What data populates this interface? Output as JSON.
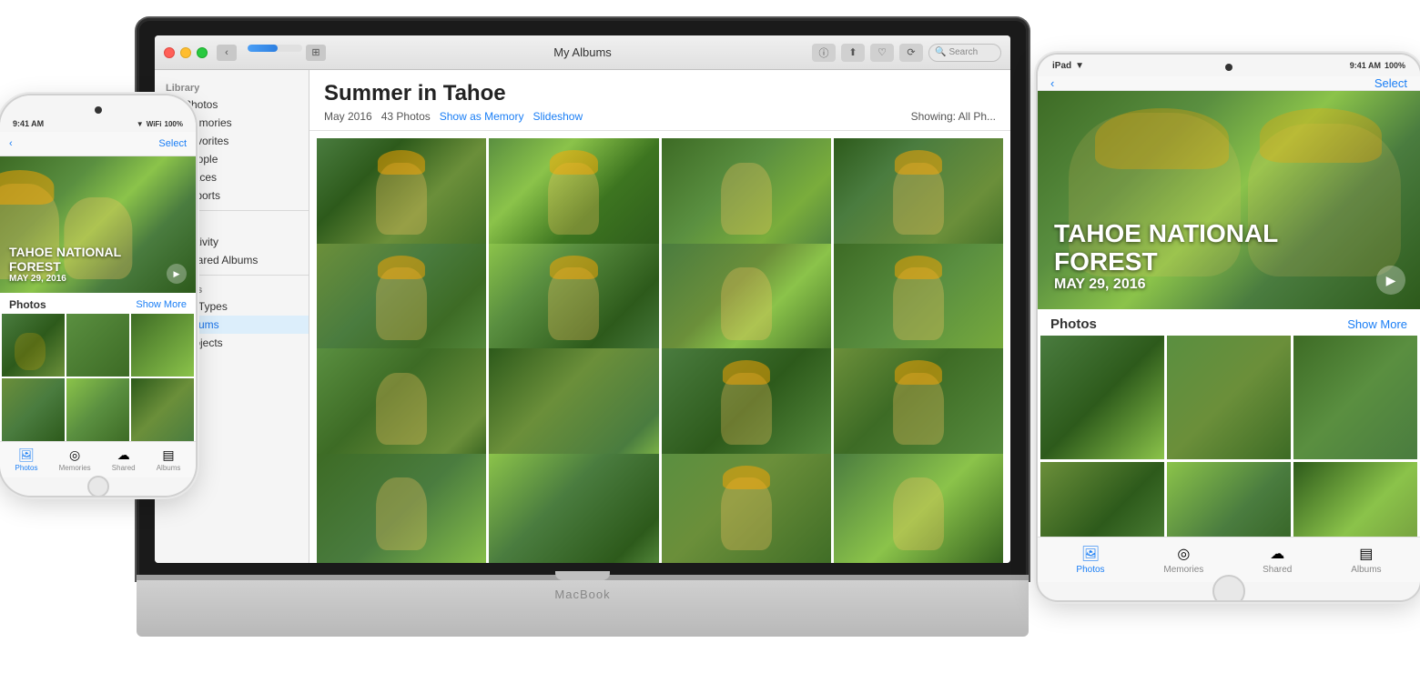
{
  "page": {
    "bg_color": "#ffffff"
  },
  "macbook": {
    "label": "MacBook"
  },
  "photos_app": {
    "title_bar": {
      "title": "My Albums",
      "search_placeholder": "Search",
      "back_label": "‹",
      "forward_label": "›"
    },
    "sidebar": {
      "library_header": "Library",
      "items": [
        {
          "label": "Photos",
          "icon": "🖼"
        },
        {
          "label": "Memories",
          "icon": "◎"
        },
        {
          "label": "Favorites",
          "icon": "♡"
        },
        {
          "label": "People",
          "icon": "👤"
        },
        {
          "label": "Places",
          "icon": "📍"
        },
        {
          "label": "Imports",
          "icon": "↓"
        }
      ],
      "shared_header": "Shared",
      "shared_items": [
        {
          "label": "Activity",
          "icon": "☁"
        },
        {
          "label": "Shared Albums",
          "icon": "▶"
        }
      ],
      "albums_header": "Albums",
      "album_items": [
        {
          "label": "Media Types"
        },
        {
          "label": "My Albums"
        },
        {
          "label": "My Projects"
        }
      ]
    },
    "album": {
      "title": "Summer in Tahoe",
      "date": "May 2016",
      "count": "43 Photos",
      "show_as_memory": "Show as Memory",
      "slideshow": "Slideshow",
      "showing": "Showing: All Ph..."
    }
  },
  "iphone": {
    "status_bar": {
      "time": "9:41 AM",
      "battery": "100%"
    },
    "nav": {
      "back_label": "‹",
      "select_label": "Select"
    },
    "memory": {
      "title": "TAHOE NATIONAL\nFOREST",
      "date": "MAY 29, 2016"
    },
    "section": {
      "title": "Photos",
      "show_more": "Show More"
    },
    "bottom_tabs": [
      {
        "label": "Photos",
        "icon": "🖼",
        "active": true
      },
      {
        "label": "Memories",
        "icon": "◎",
        "active": false
      },
      {
        "label": "Shared",
        "icon": "☁",
        "active": false
      },
      {
        "label": "Albums",
        "icon": "▤",
        "active": false
      }
    ]
  },
  "ipad": {
    "status_bar": {
      "device": "iPad",
      "wifi": "▼",
      "time": "9:41 AM",
      "battery": "100%"
    },
    "nav": {
      "back_label": "‹",
      "select_label": "Select"
    },
    "memory": {
      "title": "TAHOE NATIONAL\nFOREST",
      "date": "MAY 29, 2016"
    },
    "section": {
      "title": "Photos",
      "show_more": "Show More"
    },
    "bottom_tabs": [
      {
        "label": "Photos",
        "icon": "🖼",
        "active": true
      },
      {
        "label": "Memories",
        "icon": "◎",
        "active": false
      },
      {
        "label": "Shared",
        "icon": "☁",
        "active": false
      },
      {
        "label": "Albums",
        "icon": "▤",
        "active": false
      }
    ]
  }
}
